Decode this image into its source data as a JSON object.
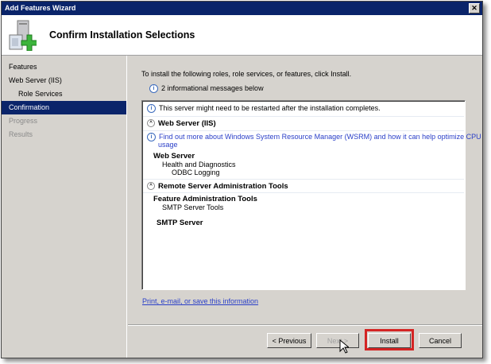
{
  "window": {
    "title": "Add Features Wizard",
    "close_label": "✕"
  },
  "header": {
    "title": "Confirm Installation Selections",
    "icon": "server-add-icon"
  },
  "nav": {
    "items": [
      {
        "label": "Features",
        "state": "normal"
      },
      {
        "label": "Web Server (IIS)",
        "state": "normal"
      },
      {
        "label": "Role Services",
        "state": "indented"
      },
      {
        "label": "Confirmation",
        "state": "selected"
      },
      {
        "label": "Progress",
        "state": "disabled"
      },
      {
        "label": "Results",
        "state": "disabled"
      }
    ]
  },
  "content": {
    "instruction": "To install the following roles, role services, or features, click Install.",
    "info_count": "2 informational messages below",
    "list": {
      "restart_msg": "This server might need to be restarted after the installation completes.",
      "sec1": "Web Server (IIS)",
      "wsrm_link_1": "Find out more about Windows System Resource Manager (WSRM) and how it can help optimize CPU",
      "wsrm_link_2": "usage",
      "web_server": "Web Server",
      "health": "Health and Diagnostics",
      "odbc": "ODBC Logging",
      "sec2": "Remote Server Administration Tools",
      "fat": "Feature Administration Tools",
      "smtp_tools": "SMTP Server Tools",
      "smtp_server": "SMTP Server"
    },
    "print_link": "Print, e-mail, or save this information"
  },
  "buttons": {
    "previous": "< Previous",
    "next": "Next >",
    "install": "Install",
    "cancel": "Cancel"
  },
  "colors": {
    "titlebar": "#0a246a",
    "highlight": "#d42424",
    "link": "#2a3fc8"
  }
}
